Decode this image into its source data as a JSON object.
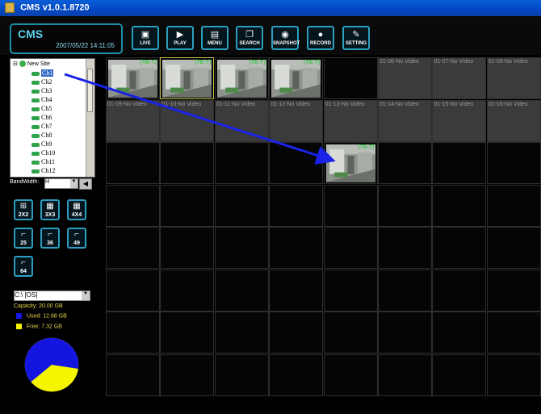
{
  "window": {
    "title": "CMS  v1.0.1.8720"
  },
  "header": {
    "logo": "CMS",
    "datetime": "2007/05/22 14:11:05",
    "buttons": [
      {
        "id": "live",
        "label": "LIVE",
        "icon": "monitor-icon"
      },
      {
        "id": "play",
        "label": "PLAY",
        "icon": "play-icon"
      },
      {
        "id": "menu",
        "label": "MENU",
        "icon": "menu-icon"
      },
      {
        "id": "search",
        "label": "SEARCH",
        "icon": "search-icon"
      },
      {
        "id": "snapshot",
        "label": "SNAPSHOT",
        "icon": "eye-icon"
      },
      {
        "id": "record",
        "label": "RECORD",
        "icon": "record-icon"
      },
      {
        "id": "setting",
        "label": "SETTING",
        "icon": "wrench-icon"
      }
    ]
  },
  "tree": {
    "root": "New Site",
    "channels": [
      "Ch1",
      "Ch2",
      "Ch3",
      "Ch4",
      "Ch5",
      "Ch6",
      "Ch7",
      "Ch8",
      "Ch9",
      "Ch10",
      "Ch11",
      "Ch12"
    ],
    "selected": "Ch1"
  },
  "bandwidth": {
    "label": "BandWidth:",
    "value": "H"
  },
  "layouts": [
    "2X2",
    "3X3",
    "4X4"
  ],
  "counts": [
    "25",
    "36",
    "49",
    "64"
  ],
  "storage": {
    "drive": "C:\\ [OS]",
    "capacity": "Capacity: 20.00 GB",
    "used": "Used: 12.68 GB",
    "free": "Free: 7.32 GB",
    "used_color": "#1515e0",
    "free_color": "#f5f500",
    "used_fraction": 0.634
  },
  "grid": {
    "no_video_labels": {
      "0-5": "01-06-No Video",
      "0-6": "01-07-No Video",
      "0-7": "01-08-No Video",
      "1-0": "01-09-No Video",
      "1-1": "01-10-No Video",
      "1-2": "01-11-No Video",
      "1-3": "01-12-No Video",
      "1-4": "01-13-No Video",
      "1-5": "01-14-No Video",
      "1-6": "01-15-No Video",
      "1-7": "01-16-No Video"
    },
    "video_cells": [
      "0-0",
      "0-1",
      "0-2",
      "0-3",
      "2-4"
    ],
    "overlay_tag": "(TE-T)"
  }
}
